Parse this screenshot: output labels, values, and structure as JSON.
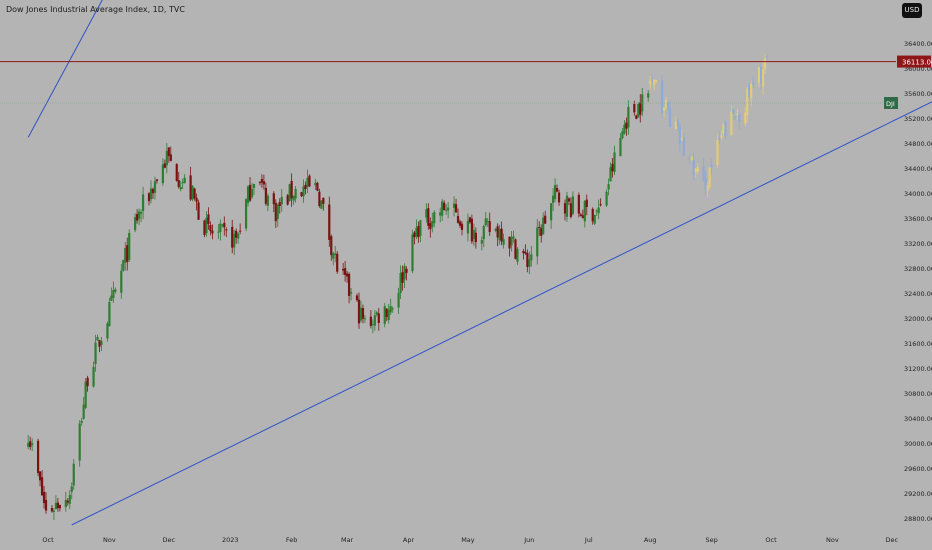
{
  "header": {
    "title": "Dow Jones Industrial Average Index, 1D, TVC",
    "currency": "USD"
  },
  "colors": {
    "background": "#b4b4b4",
    "up": "#2e7d32",
    "down": "#7a1212",
    "projection_up": "#e2cc78",
    "projection_down": "#8faad8",
    "trendline": "#2f52c8",
    "resistance": "#8e1616",
    "last_price_line": "#7aa285"
  },
  "chart_data": {
    "type": "candlestick",
    "title": "Dow Jones Industrial Average Index, 1D, TVC",
    "x_ticks": [
      "Oct",
      "Nov",
      "Dec",
      "2023",
      "Feb",
      "Mar",
      "Apr",
      "May",
      "Jun",
      "Jul",
      "Aug",
      "Sep",
      "Oct",
      "Nov",
      "Dec"
    ],
    "y_ticks": [
      28800,
      29200,
      29600,
      30000,
      30400,
      30800,
      31200,
      31600,
      32000,
      32400,
      32800,
      33200,
      33600,
      34000,
      34400,
      34800,
      35200,
      35600,
      36000,
      36400
    ],
    "ylim": [
      28650,
      36650
    ],
    "resistance_level": 36113.0,
    "resistance_label": "36113.00",
    "symbol_tag": "DJI",
    "last_close": 35450,
    "grid": false,
    "close_path": [
      {
        "date": "2022-09-21",
        "close": 30200
      },
      {
        "date": "2022-09-30",
        "close": 28900
      },
      {
        "date": "2022-10-12",
        "close": 29210
      },
      {
        "date": "2022-10-21",
        "close": 31080
      },
      {
        "date": "2022-11-04",
        "close": 32400
      },
      {
        "date": "2022-11-14",
        "close": 33540
      },
      {
        "date": "2022-11-30",
        "close": 34580
      },
      {
        "date": "2022-12-13",
        "close": 33960
      },
      {
        "date": "2022-12-21",
        "close": 33380
      },
      {
        "date": "2023-01-04",
        "close": 33270
      },
      {
        "date": "2023-01-13",
        "close": 34300
      },
      {
        "date": "2023-01-24",
        "close": 33730
      },
      {
        "date": "2023-02-02",
        "close": 34050
      },
      {
        "date": "2023-02-14",
        "close": 34090
      },
      {
        "date": "2023-02-24",
        "close": 32820
      },
      {
        "date": "2023-03-10",
        "close": 31910
      },
      {
        "date": "2023-03-24",
        "close": 32240
      },
      {
        "date": "2023-04-06",
        "close": 33480
      },
      {
        "date": "2023-04-20",
        "close": 33790
      },
      {
        "date": "2023-05-03",
        "close": 33410
      },
      {
        "date": "2023-05-18",
        "close": 33420
      },
      {
        "date": "2023-05-31",
        "close": 32910
      },
      {
        "date": "2023-06-14",
        "close": 33980
      },
      {
        "date": "2023-06-26",
        "close": 33710
      },
      {
        "date": "2023-07-07",
        "close": 33730
      },
      {
        "date": "2023-07-20",
        "close": 35220
      },
      {
        "date": "2023-07-31",
        "close": 35560
      }
    ],
    "projection_path": [
      {
        "date": "2023-08-01",
        "close": 35800
      },
      {
        "date": "2023-08-10",
        "close": 35300
      },
      {
        "date": "2023-08-18",
        "close": 34700
      },
      {
        "date": "2023-08-28",
        "close": 34100
      },
      {
        "date": "2023-09-08",
        "close": 35050
      },
      {
        "date": "2023-09-18",
        "close": 35450
      },
      {
        "date": "2023-09-29",
        "close": 36120
      }
    ],
    "trendlines": [
      {
        "points": [
          {
            "date": "2022-10-13",
            "close": 28700
          },
          {
            "date": "2023-12-31",
            "close": 35620
          }
        ]
      },
      {
        "points": [
          {
            "date": "2022-09-21",
            "close": 34900
          },
          {
            "date": "2022-12-15",
            "close": 39900
          }
        ]
      }
    ]
  }
}
